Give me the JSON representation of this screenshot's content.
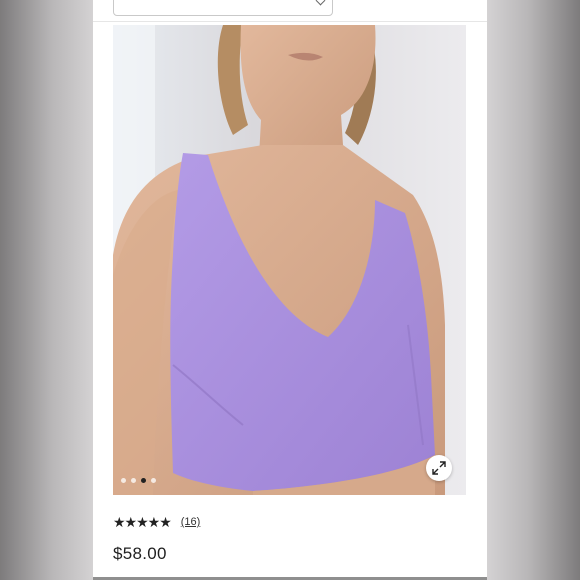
{
  "product": {
    "rating_stars": "★★★★★",
    "review_count": "(16)",
    "price": "$58.00"
  },
  "gallery": {
    "total_images": 4,
    "active_index": 2
  },
  "icons": {
    "expand": "expand-arrows-icon",
    "dropdown": "chevron-down-icon"
  },
  "colors": {
    "top_color": "#a98fdc",
    "card_background": "#ffffff",
    "text": "#1f1f1f"
  }
}
